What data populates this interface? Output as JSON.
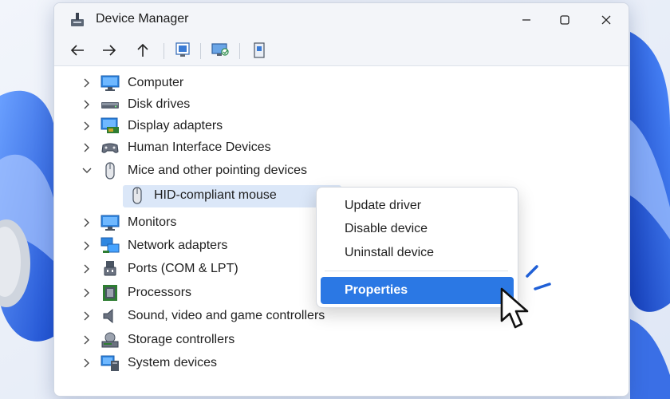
{
  "window": {
    "title": "Device Manager"
  },
  "titlebar_buttons": [
    "minimize-icon",
    "maximize-icon",
    "close-icon"
  ],
  "toolbar": {
    "buttons": [
      "back-arrow-icon",
      "forward-arrow-icon",
      "up-arrow-icon",
      "properties-icon",
      "scan-hardware-icon",
      "device-view-icon"
    ]
  },
  "tree": {
    "items": [
      {
        "label": "Computer",
        "icon": "computer-icon",
        "expanded": false
      },
      {
        "label": "Disk drives",
        "icon": "disk-drive-icon",
        "expanded": false
      },
      {
        "label": "Display adapters",
        "icon": "display-adapter-icon",
        "expanded": false
      },
      {
        "label": "Human Interface Devices",
        "icon": "hid-icon",
        "expanded": false
      },
      {
        "label": "Mice and other pointing devices",
        "icon": "mouse-icon",
        "expanded": true
      },
      {
        "label": "HID-compliant mouse",
        "icon": "mouse-icon",
        "child": true,
        "selected": true
      },
      {
        "label": "Monitors",
        "icon": "monitor-icon",
        "expanded": false
      },
      {
        "label": "Network adapters",
        "icon": "network-adapter-icon",
        "expanded": false
      },
      {
        "label": "Ports (COM & LPT)",
        "icon": "port-icon",
        "expanded": false
      },
      {
        "label": "Processors",
        "icon": "processor-icon",
        "expanded": false
      },
      {
        "label": "Sound, video and game controllers",
        "icon": "speaker-icon",
        "expanded": false
      },
      {
        "label": "Storage controllers",
        "icon": "storage-controller-icon",
        "expanded": false
      },
      {
        "label": "System devices",
        "icon": "system-devices-icon",
        "expanded": false
      }
    ]
  },
  "context_menu": {
    "items": [
      "Update driver",
      "Disable device",
      "Uninstall device"
    ],
    "highlighted": "Properties"
  },
  "colors": {
    "accent": "#2b78e4",
    "selection": "#dbe7f8",
    "wallpaper_blue": "#2a63e0"
  }
}
